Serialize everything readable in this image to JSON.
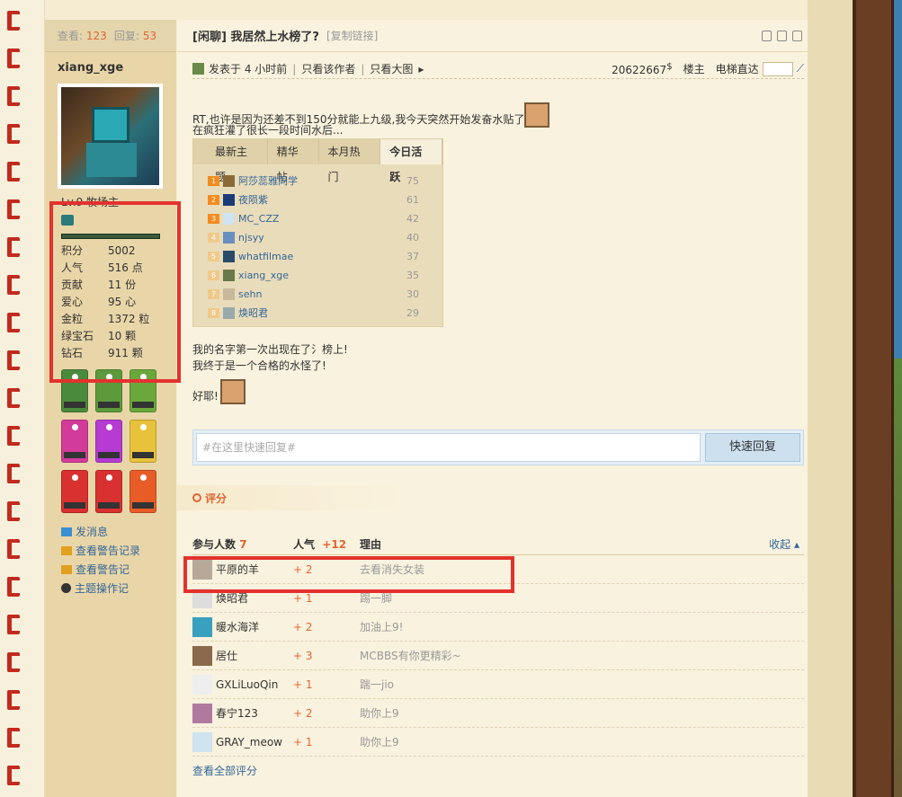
{
  "thread": {
    "views_label": "查看:",
    "views": "123",
    "replies_label": "回复:",
    "replies": "53",
    "title": "[闲聊] 我居然上水榜了?",
    "copy_link": "[复制链接]"
  },
  "user": {
    "name": "xiang_xge",
    "level": "Lv.9 牧场主",
    "stats": [
      {
        "k": "积分",
        "v": "5002"
      },
      {
        "k": "人气",
        "v": "516 点"
      },
      {
        "k": "贡献",
        "v": "11 份"
      },
      {
        "k": "爱心",
        "v": "95 心"
      },
      {
        "k": "金粒",
        "v": "1372 粒"
      },
      {
        "k": "绿宝石",
        "v": "10 颗"
      },
      {
        "k": "钻石",
        "v": "911 颗"
      }
    ],
    "medals": [
      {
        "color": "#4a8a3c"
      },
      {
        "color": "#5c9a3c"
      },
      {
        "color": "#6aa83c"
      },
      {
        "color": "#d33b9a"
      },
      {
        "color": "#b53bd3"
      },
      {
        "color": "#e8c23a"
      },
      {
        "color": "#d93030"
      },
      {
        "color": "#d93030"
      },
      {
        "color": "#e85c28"
      }
    ],
    "links": [
      "发消息",
      "查看警告记录",
      "查看警告记",
      "主题操作记"
    ]
  },
  "postinfo": {
    "posted": "发表于 4 小时前",
    "only_author": "只看该作者",
    "big_image": "只看大图",
    "uid": "20622667",
    "floor": "楼主",
    "elevator": "电梯直达"
  },
  "post": {
    "line1": "RT,也许是因为还差不到150分就能上九级,我今天突然开始发奋水贴了",
    "line2": "在疯狂灌了很长一段时间水后...",
    "line3": "我的名字第一次出现在了氵榜上!",
    "line4": "我终于是一个合格的水怪了!",
    "line5": "好耶!"
  },
  "widget": {
    "tabs": [
      "最新主题",
      "精华帖",
      "本月热门",
      "今日活跃"
    ],
    "rows": [
      {
        "rank": "1",
        "name": "阿莎蕊雅同学",
        "count": "75"
      },
      {
        "rank": "2",
        "name": "夜陨紫",
        "count": "61"
      },
      {
        "rank": "3",
        "name": "MC_CZZ",
        "count": "42"
      },
      {
        "rank": "4",
        "name": "njsyy",
        "count": "40"
      },
      {
        "rank": "5",
        "name": "whatfilmae",
        "count": "37"
      },
      {
        "rank": "6",
        "name": "xiang_xge",
        "count": "35"
      },
      {
        "rank": "7",
        "name": "sehn",
        "count": "30"
      },
      {
        "rank": "8",
        "name": "焕昭君",
        "count": "29"
      }
    ]
  },
  "reply": {
    "placeholder": "#在这里快速回复#",
    "button": "快速回复"
  },
  "rating": {
    "section": "评分",
    "h_participants": "参与人数",
    "participants": "7",
    "h_pop": "人气",
    "pop_total": "+12",
    "h_reason": "理由",
    "collapse": "收起",
    "rows": [
      {
        "name": "平原的羊",
        "score": "+ 2",
        "reason": "去看消失女装"
      },
      {
        "name": "焕昭君",
        "score": "+ 1",
        "reason": "踢一脚"
      },
      {
        "name": "暖水海洋",
        "score": "+ 2",
        "reason": "加油上9!"
      },
      {
        "name": "居仕",
        "score": "+ 3",
        "reason": "MCBBS有你更精彩~"
      },
      {
        "name": "GXLiLuoQin",
        "score": "+ 1",
        "reason": "踹一jio"
      },
      {
        "name": "春宁123",
        "score": "+ 2",
        "reason": "助你上9"
      },
      {
        "name": "GRAY_meow",
        "score": "+ 1",
        "reason": "助你上9"
      }
    ],
    "view_all": "查看全部评分"
  }
}
